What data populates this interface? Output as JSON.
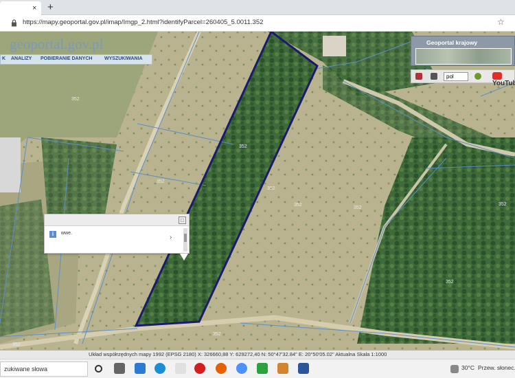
{
  "browser": {
    "tab_close": "×",
    "new_tab": "+",
    "url": "https://mapy.geoportal.gov.pl/imap/Imgp_2.html?identifyParcel=260405_5.0011.352",
    "star_icon": "star-icon"
  },
  "header": {
    "logo": "geoportal.gov.pl",
    "nav": [
      "K",
      "ANALIZY",
      "POBIERANIE DANYCH",
      "WYSZUKIWANIA"
    ]
  },
  "widget": {
    "title": "Geoportal krajowy",
    "language": "pol",
    "youtube": "YouTube"
  },
  "popup": {
    "text": "wwe."
  },
  "parcel_labels": [
    "352",
    "352",
    "352",
    "352",
    "352",
    "352",
    "352",
    "352",
    "352",
    "352"
  ],
  "status": {
    "coords": "Układ współrzędnych mapy 1992 (EPSG 2180)   X: 326660,88  Y: 629272,40   N: 50°47'32.84\"  E: 20°50'05.02\"  Aktualna Skala 1:1000"
  },
  "taskbar": {
    "search_text": "zukiwane słowa",
    "tray_temp": "30°C",
    "tray_weather": "Przew. słonec..."
  },
  "colors": {
    "parcel_outline": "#1a1a6e",
    "boundary_lines": "#5b8fc9",
    "nav_bg": "#dce8f4"
  }
}
